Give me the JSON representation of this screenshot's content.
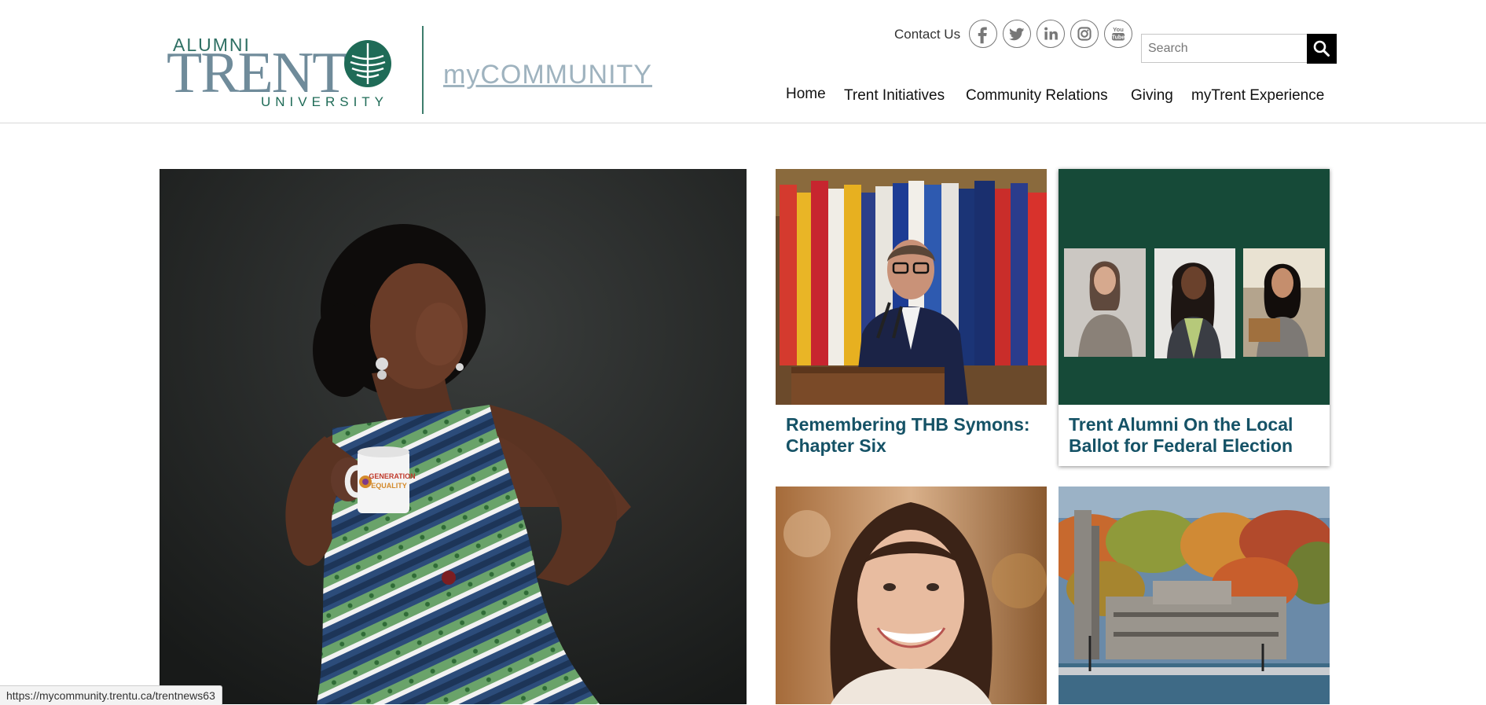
{
  "header": {
    "logo": {
      "alumni": "ALUMNI",
      "trent": "TRENT",
      "university": "UNIVERSITY",
      "site_name": "myCOMMUNITY"
    },
    "contact_label": "Contact Us",
    "social": [
      {
        "icon": "facebook-icon"
      },
      {
        "icon": "twitter-icon"
      },
      {
        "icon": "linkedin-icon"
      },
      {
        "icon": "instagram-icon"
      },
      {
        "icon": "youtube-icon"
      }
    ],
    "search": {
      "placeholder": "Search",
      "value": ""
    },
    "nav": [
      {
        "label": "Home"
      },
      {
        "label": "Trent Initiatives"
      },
      {
        "label": "Community Relations"
      },
      {
        "label": "Giving"
      },
      {
        "label": "myTrent Experience"
      }
    ]
  },
  "main": {
    "hero": {
      "image": "woman-in-patterned-dress-holding-mug-photo",
      "mug_text": "GENERATION EQUALITY"
    },
    "cards": [
      {
        "title": "Remembering THB Symons: Chapter Six",
        "image": "speaker-at-podium-with-flags-photo"
      },
      {
        "title": "Trent Alumni On the Local Ballot for Federal Election",
        "image": "three-candidate-portraits-photo"
      },
      {
        "title": "",
        "image": "smiling-young-woman-portrait-photo"
      },
      {
        "title": "",
        "image": "campus-buildings-autumn-photo"
      }
    ]
  },
  "status_bar": {
    "url": "https://mycommunity.trentu.ca/trentnews63"
  },
  "colors": {
    "brand_green": "#1f6b57",
    "title_blue": "#155266",
    "card_green_bg": "#164a38",
    "accent_black": "#000000"
  }
}
